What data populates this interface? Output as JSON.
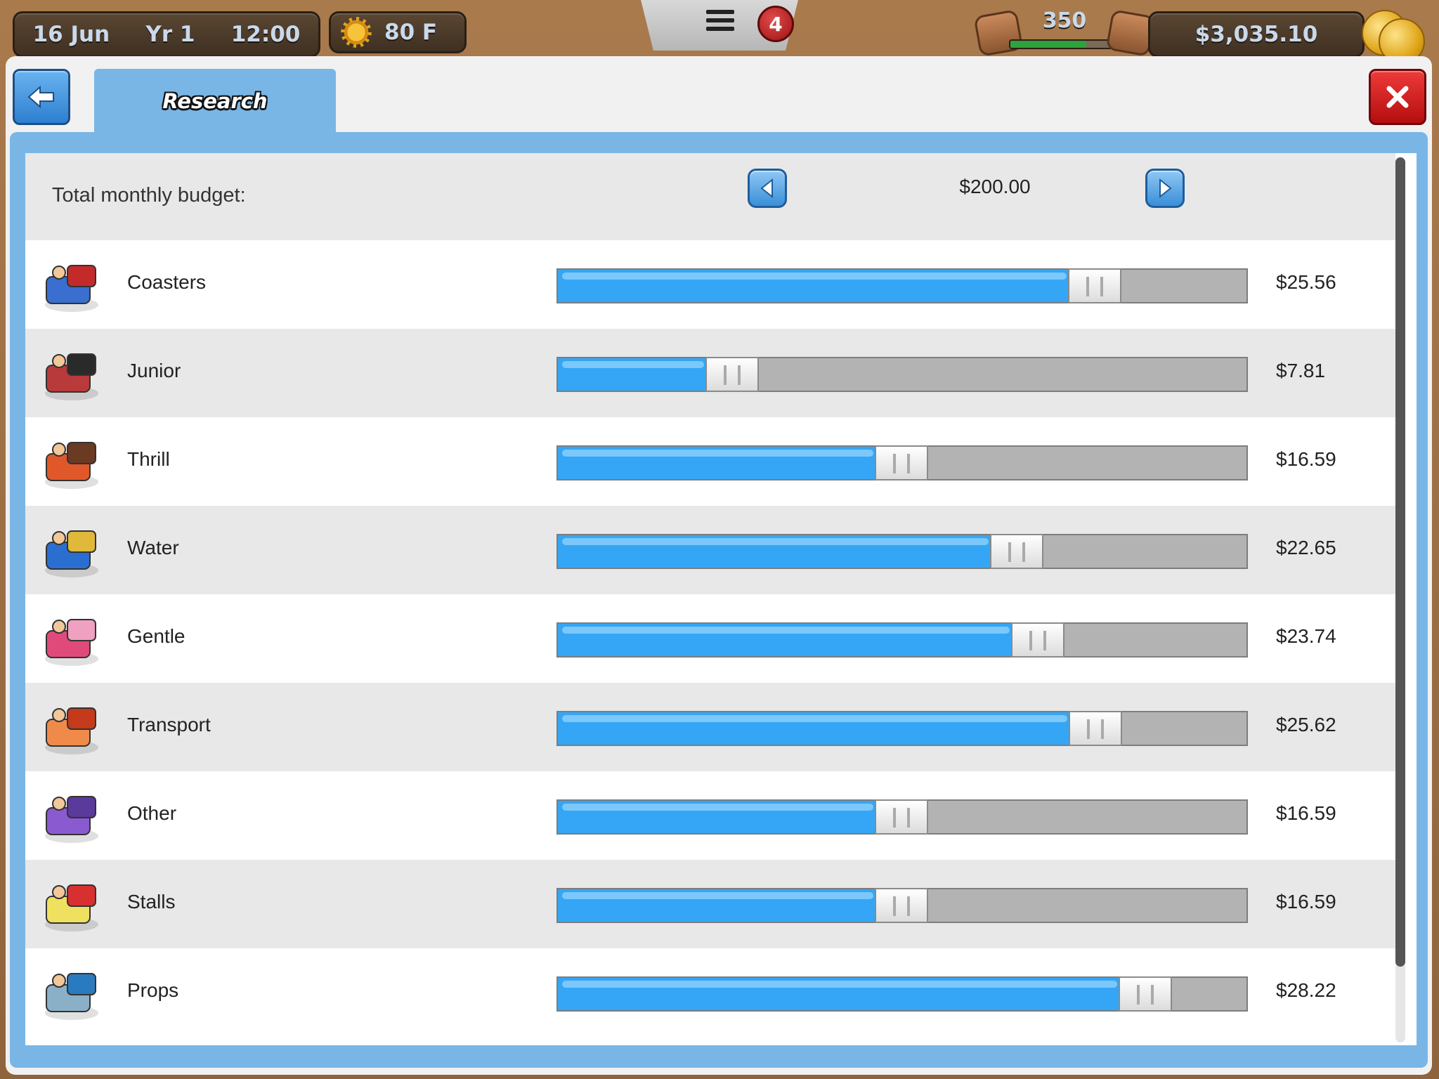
{
  "hud": {
    "date": "16 Jun",
    "year": "Yr 1",
    "time": "12:00",
    "temperature": "80 F",
    "notifications": "4",
    "rating": "350",
    "rating_fill": 0.72,
    "money": "$3,035.10"
  },
  "dialog": {
    "tab_label": "Research",
    "budget_label": "Total monthly budget:",
    "budget_value": "$200.00"
  },
  "research": {
    "categories": [
      {
        "label": "Coasters",
        "amount": "$25.56",
        "level": 0.745,
        "icon": "coaster-icon"
      },
      {
        "label": "Junior",
        "amount": "$7.81",
        "level": 0.218,
        "icon": "junior-ride-icon"
      },
      {
        "label": "Thrill",
        "amount": "$16.59",
        "level": 0.464,
        "icon": "thrill-ride-icon"
      },
      {
        "label": "Water",
        "amount": "$22.65",
        "level": 0.632,
        "icon": "water-ride-icon"
      },
      {
        "label": "Gentle",
        "amount": "$23.74",
        "level": 0.662,
        "icon": "gentle-ride-icon"
      },
      {
        "label": "Transport",
        "amount": "$25.62",
        "level": 0.746,
        "icon": "transport-icon"
      },
      {
        "label": "Other",
        "amount": "$16.59",
        "level": 0.464,
        "icon": "other-ride-icon"
      },
      {
        "label": "Stalls",
        "amount": "$16.59",
        "level": 0.464,
        "icon": "stall-icon"
      },
      {
        "label": "Props",
        "amount": "$28.22",
        "level": 0.818,
        "icon": "fountain-prop-icon"
      }
    ]
  },
  "colors": {
    "accent_blue": "#79b6e6",
    "slider_fill": "#34a6f5",
    "close_red": "#d41b1b"
  }
}
